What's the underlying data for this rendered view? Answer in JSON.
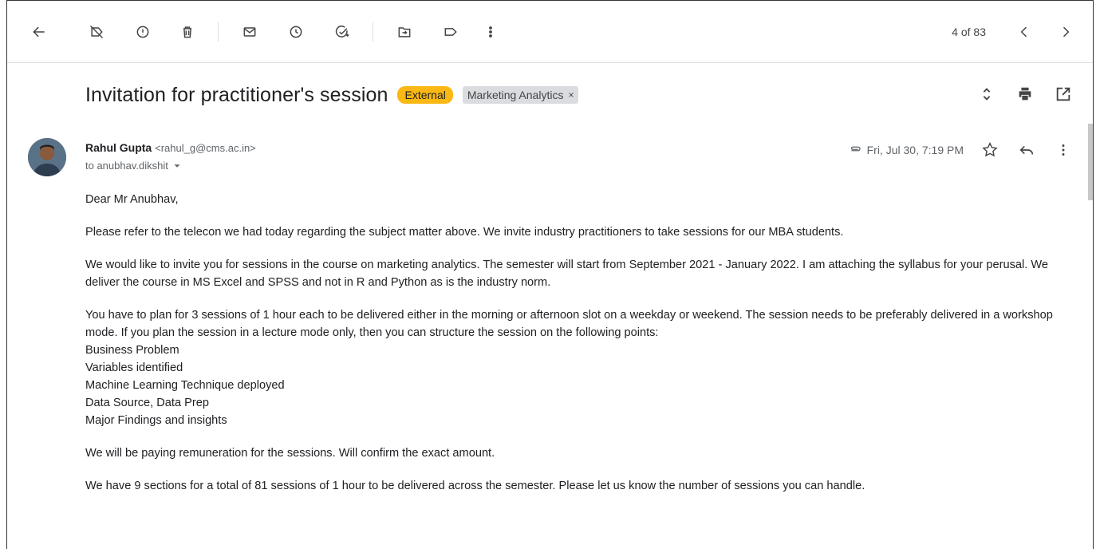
{
  "toolbar": {
    "counter": "4 of 83",
    "icons": [
      "back-arrow-icon",
      "label-off-icon",
      "report-spam-icon",
      "delete-icon",
      "mark-unread-icon",
      "snooze-icon",
      "add-task-icon",
      "move-to-icon",
      "label-icon",
      "more-vert-icon",
      "prev-icon",
      "next-icon"
    ]
  },
  "subject": {
    "title": "Invitation for practitioner's session",
    "badge_external": "External",
    "badge_label": "Marketing Analytics",
    "badge_label_close": "×"
  },
  "message": {
    "sender_name": "Rahul Gupta",
    "sender_email": "<rahul_g@cms.ac.in>",
    "to_line": "to anubhav.dikshit",
    "date": "Fri, Jul 30, 7:19 PM"
  },
  "body": {
    "greeting": "Dear Mr Anubhav,",
    "p1": "Please refer to the telecon we had today regarding the subject matter above. We invite industry practitioners to take sessions for our MBA students.",
    "p2": "We would like to invite you for sessions in the course on marketing analytics. The semester will start from September 2021 - January 2022. I am attaching the syllabus for your perusal. We deliver the course in MS Excel and SPSS and not in R and Python as is the industry norm.",
    "p3": "You have to plan for 3 sessions of  1 hour each to be delivered either in the morning or afternoon slot on a weekday or weekend. The session needs to be preferably delivered in a workshop mode. If you plan the session in a lecture mode only, then you can structure the session on the following points:",
    "points": [
      "Business Problem",
      "Variables identified",
      "Machine Learning Technique deployed",
      "Data Source, Data Prep",
      "Major Findings and insights"
    ],
    "p4": "We will be paying remuneration for the sessions. Will confirm the exact amount.",
    "p5": "We have 9 sections for a total of 81 sessions of 1 hour to be delivered across the semester. Please let us know the number of sessions you can handle."
  },
  "colors": {
    "external_badge": "#f9b813",
    "label_badge": "#dadce0"
  }
}
